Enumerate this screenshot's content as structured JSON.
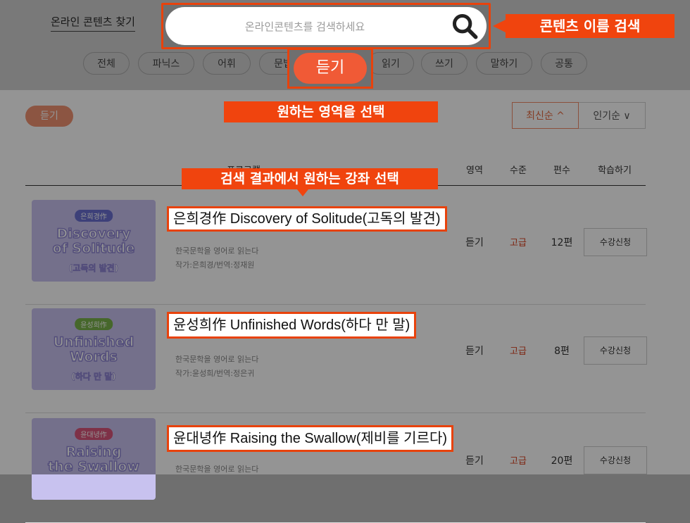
{
  "header": {
    "finder_title": "온라인 콘텐츠 찾기",
    "search_placeholder": "온라인콘텐츠를 검색하세요",
    "search_icon": "search-icon",
    "categories": [
      "전체",
      "파닉스",
      "어휘",
      "문법",
      "듣기",
      "읽기",
      "쓰기",
      "말하기",
      "공통"
    ],
    "selected_category": "듣기"
  },
  "filter": {
    "selected_chip": "듣기",
    "sort_latest": "최신순 ^",
    "sort_popular": "인기순 ∨"
  },
  "table": {
    "columns": [
      "프로그램",
      "영역",
      "수준",
      "편수",
      "학습하기"
    ],
    "rows": [
      {
        "badge": "은희경作",
        "thumb_title": [
          "Discovery",
          "of Solitude"
        ],
        "thumb_sub": "(고독의 발견)",
        "title": "은희경作 Discovery of Solitude(고독의 발견)",
        "desc": "한국문학을 영어로 읽는다",
        "author": "작가:은희경/번역:정재원",
        "area": "듣기",
        "level": "고급",
        "count": "12편",
        "button": "수강신청"
      },
      {
        "badge": "윤성희作",
        "thumb_title": [
          "Unfinished",
          "Words"
        ],
        "thumb_sub": "(하다 만 말)",
        "title": "윤성희作 Unfinished Words(하다 만 말)",
        "desc": "한국문학을 영어로 읽는다",
        "author": "작가:윤성희/번역:정은귀",
        "area": "듣기",
        "level": "고급",
        "count": "8편",
        "button": "수강신청"
      },
      {
        "badge": "윤대녕作",
        "thumb_title": [
          "Raising",
          "the Swallow"
        ],
        "thumb_sub": "",
        "title": "윤대녕作 Raising the Swallow(제비를 기르다)",
        "desc": "한국문학을 영어로 읽는다",
        "author": "",
        "area": "듣기",
        "level": "고급",
        "count": "20편",
        "button": "수강신청"
      }
    ]
  },
  "callouts": {
    "search": "콘텐츠 이름 검색",
    "area": "원하는 영역을 선택",
    "result": "검색 결과에서 원하는 강좌 선택"
  },
  "colors": {
    "accent": "#f0440e",
    "highlight_border": "#e8420c",
    "selected_pill": "#f05a36",
    "level_text": "#d9411f",
    "thumb_bg": "#c8c2ef"
  }
}
